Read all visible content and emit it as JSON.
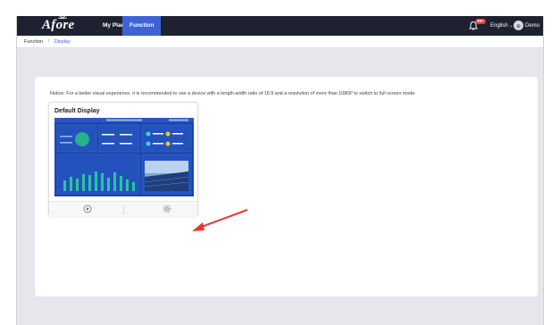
{
  "header": {
    "logo": "Afore",
    "nav": [
      {
        "label": "My Plant",
        "active": false
      },
      {
        "label": "Function",
        "active": true
      }
    ],
    "notification_badge": "99+",
    "language": "English",
    "user": "Demo"
  },
  "breadcrumb": {
    "root": "Function",
    "separator": "/",
    "current": "Display"
  },
  "notice": "Notice: For a better visual experience, it is recommended to use a device with a length-width ratio of 16:9 and a resolution of more than 1080P to switch to full screen mode",
  "display_card": {
    "title": "Default Display",
    "actions": [
      {
        "icon": "play-icon"
      },
      {
        "icon": "gear-icon"
      }
    ],
    "preview_icon": "dashboard-preview"
  },
  "colors": {
    "topbar": "#1e2130",
    "accent": "#3d63d6",
    "arrow": "#e53935",
    "preview_bg": "#1d46a8"
  }
}
